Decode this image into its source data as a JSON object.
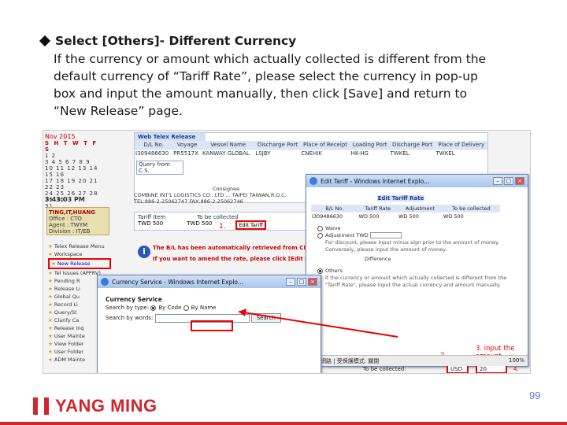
{
  "slide": {
    "bullet_title": "Select [Others]- Different Currency",
    "body_lines": [
      "If the currency or amount which actually collected is different from the",
      "default  currency of “Tariff Rate”,  please  select  the currency in pop-up",
      "box and input the amount manually, then click [Save] and return to",
      "“New Release” page."
    ],
    "page_number": "99",
    "brand": "YANG MING"
  },
  "calendar": {
    "month": "Nov 2015",
    "weekdays": "S H T W T F S",
    "time": "3:43:03 PM"
  },
  "user": {
    "name": "TING,IT,HUANG",
    "office": "Office : CTO",
    "agent": "Agent : TWYM",
    "division": "Division : IT/EB"
  },
  "menu": {
    "items": [
      "Telex Release Menu",
      "Workspace",
      "New Release",
      "Tel Issues (APPRV)",
      "Pending R",
      "Release Li",
      "Global Qu",
      "Record Li",
      "Query/St",
      "Clarify Ca",
      "Release Inq",
      "User Mainte",
      "View Folder",
      "User Folder",
      "ADM Mainte",
      "Event Setup"
    ]
  },
  "web_release": {
    "title": "Web Telex Release",
    "columns": [
      "D/L No.",
      "Voyage",
      "Vessel Name",
      "Discharge Port",
      "Place of Receipt",
      "Loading Port",
      "Discharge Port",
      "Place of Delivery"
    ],
    "row": [
      "I309486630",
      "PR5517X",
      "KANWAY GLOBAL",
      "LSJBY",
      "CNEHIK",
      "HK-HG",
      "TWKEL",
      "TWKEL"
    ],
    "query_label": "Query from C.S.",
    "consignee_label": "Consignee",
    "consignee_text": "COMBINE INT'L LOGISTICS CO., LTD ... TAIPEI TAIWAN,R.O.C. TEL:886-2-25062747 FAX:886-2-25062746",
    "tariff_columns": [
      "Tariff Item",
      "To be collected"
    ],
    "tariff_values": [
      "TWD 500",
      "TWD 500"
    ],
    "edit_tariff_label": "Edit Tariff",
    "step1_label": "1."
  },
  "notice": {
    "line1": "The B/L has been automatically retrieved from CIS",
    "line2": "If you want to amend the rate, please click [Edit Rate]."
  },
  "popup_tariff": {
    "window_title": "Edit Tariff - Windows Internet Explo...",
    "header": "Edit Tariff Rate",
    "columns": [
      "B/L No.",
      "Tariff Rate",
      "Adjustment",
      "To be collected"
    ],
    "row": [
      "I309486630",
      "WD  500",
      "WD  500",
      "WD  500"
    ],
    "waive_label": "Waive",
    "adjustment_label": "Adjustment",
    "adjustment_currency": "TWD",
    "adjustment_note": "For discount, please input minus sign prior to the amount of money. Conversely, please input the amount of money.",
    "difference_label": "Difference",
    "others_label": "Others",
    "others_note": "If the currency or amount which actually collected is different from the \"Tariff Rate\", please input the actual currency and amount manually.",
    "step3_label": "3. input the amount",
    "collect_label": "To be collected:",
    "currency_value": "USD",
    "amount_value": "20",
    "step2_label": "2.",
    "save_label": "Save",
    "step4_label": "4.",
    "status_text": "網際網路 | 受保護模式: 關閉",
    "zoom": "100%"
  },
  "popup_currency": {
    "window_title": "Currency Service - Windows Internet Explo...",
    "header": "Currency Service",
    "search_by_label": "Search by type:",
    "by_code": "By Code",
    "by_name": "By Name",
    "keyword_label": "Search by words:",
    "search_button": "Search"
  }
}
